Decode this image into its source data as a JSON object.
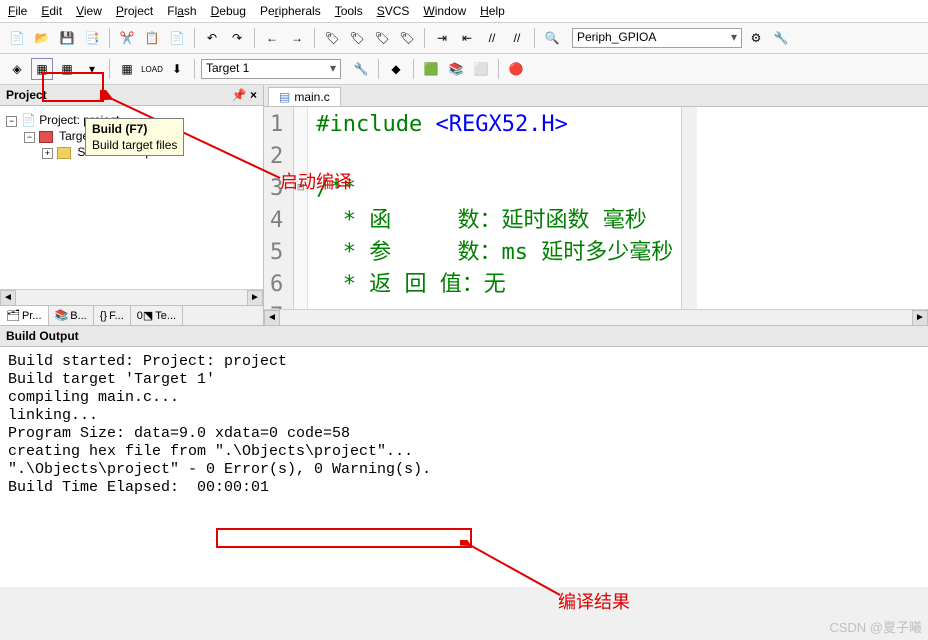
{
  "menu": {
    "items": [
      "File",
      "Edit",
      "View",
      "Project",
      "Flash",
      "Debug",
      "Peripherals",
      "Tools",
      "SVCS",
      "Window",
      "Help"
    ]
  },
  "toolbar1": {
    "periph_label": "Periph_GPIOA"
  },
  "toolbar2": {
    "target_label": "Target 1"
  },
  "project": {
    "title": "Project",
    "root": "Project: project",
    "target": "Target 1",
    "group": "Source Group 1"
  },
  "tooltip": {
    "title": "Build (F7)",
    "desc": "Build target files"
  },
  "tabs": {
    "pr": "Pr...",
    "b": "B...",
    "f": "F...",
    "te": "Te..."
  },
  "editor": {
    "tab": "main.c"
  },
  "code": {
    "l1": "#include <REGX52.H>",
    "l2": "",
    "l3": "/**",
    "l4": "  * 函     数：延时函数 毫秒",
    "l5": "  * 参     数：ms 延时多少毫秒",
    "l6": "  * 返 回 值：无"
  },
  "output": {
    "title": "Build Output",
    "lines": [
      "Build started: Project: project",
      "Build target 'Target 1'",
      "compiling main.c...",
      "linking...",
      "Program Size: data=9.0 xdata=0 code=58",
      "creating hex file from \".\\Objects\\project\"...",
      "\".\\Objects\\project\" - 0 Error(s), 0 Warning(s).",
      "Build Time Elapsed:  00:00:01"
    ]
  },
  "annotations": {
    "start_compile": "启动编译",
    "compile_result": "编译结果"
  },
  "watermark": "CSDN @夏子曦"
}
